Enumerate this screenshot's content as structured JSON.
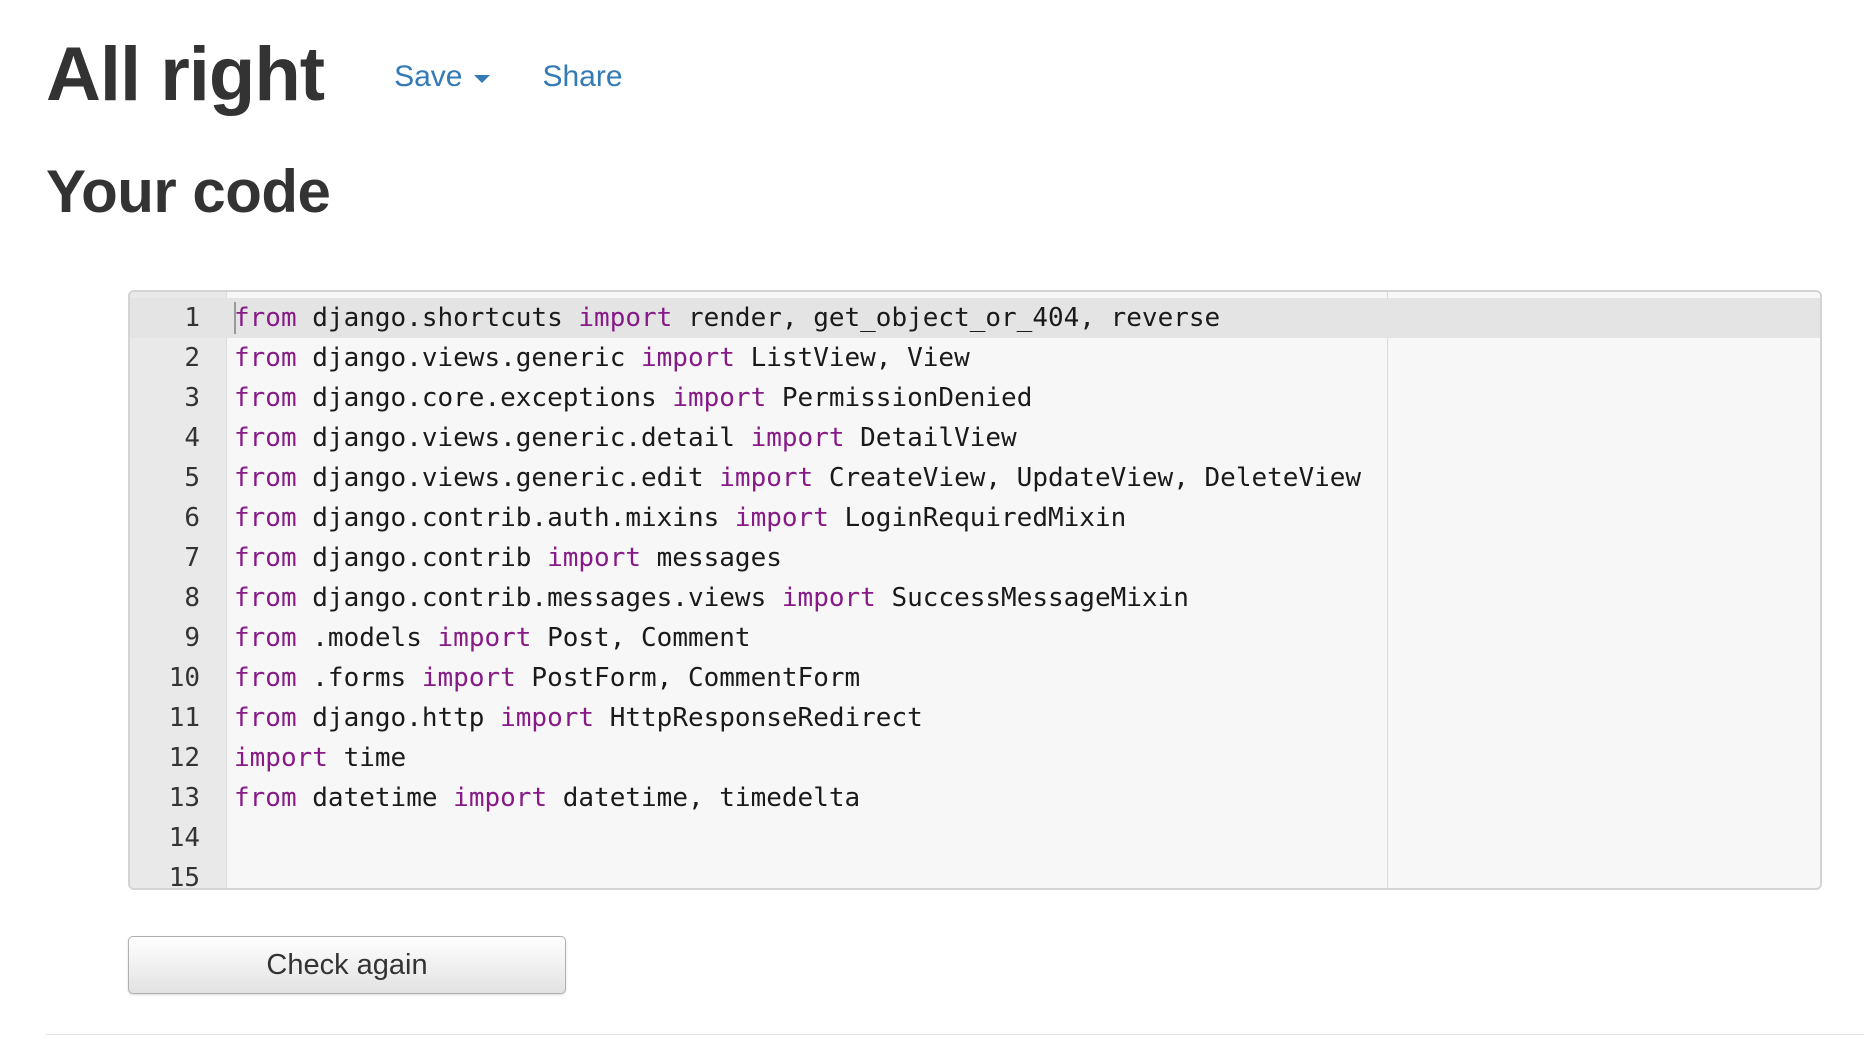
{
  "header": {
    "title": "All right",
    "save_label": "Save",
    "share_label": "Share"
  },
  "section_title": "Your code",
  "editor": {
    "lines": [
      {
        "number": "1",
        "tokens": [
          {
            "t": "from",
            "kw": true
          },
          {
            "t": " django.shortcuts ",
            "kw": false
          },
          {
            "t": "import",
            "kw": true
          },
          {
            "t": " render, get_object_or_404, reverse",
            "kw": false
          }
        ]
      },
      {
        "number": "2",
        "tokens": [
          {
            "t": "from",
            "kw": true
          },
          {
            "t": " django.views.generic ",
            "kw": false
          },
          {
            "t": "import",
            "kw": true
          },
          {
            "t": " ListView, View",
            "kw": false
          }
        ]
      },
      {
        "number": "3",
        "tokens": [
          {
            "t": "from",
            "kw": true
          },
          {
            "t": " django.core.exceptions ",
            "kw": false
          },
          {
            "t": "import",
            "kw": true
          },
          {
            "t": " PermissionDenied",
            "kw": false
          }
        ]
      },
      {
        "number": "4",
        "tokens": [
          {
            "t": "from",
            "kw": true
          },
          {
            "t": " django.views.generic.detail ",
            "kw": false
          },
          {
            "t": "import",
            "kw": true
          },
          {
            "t": " DetailView",
            "kw": false
          }
        ]
      },
      {
        "number": "5",
        "tokens": [
          {
            "t": "from",
            "kw": true
          },
          {
            "t": " django.views.generic.edit ",
            "kw": false
          },
          {
            "t": "import",
            "kw": true
          },
          {
            "t": " CreateView, UpdateView, DeleteView",
            "kw": false
          }
        ]
      },
      {
        "number": "6",
        "tokens": [
          {
            "t": "from",
            "kw": true
          },
          {
            "t": " django.contrib.auth.mixins ",
            "kw": false
          },
          {
            "t": "import",
            "kw": true
          },
          {
            "t": " LoginRequiredMixin",
            "kw": false
          }
        ]
      },
      {
        "number": "7",
        "tokens": [
          {
            "t": "from",
            "kw": true
          },
          {
            "t": " django.contrib ",
            "kw": false
          },
          {
            "t": "import",
            "kw": true
          },
          {
            "t": " messages",
            "kw": false
          }
        ]
      },
      {
        "number": "8",
        "tokens": [
          {
            "t": "from",
            "kw": true
          },
          {
            "t": " django.contrib.messages.views ",
            "kw": false
          },
          {
            "t": "import",
            "kw": true
          },
          {
            "t": " SuccessMessageMixin",
            "kw": false
          }
        ]
      },
      {
        "number": "9",
        "tokens": [
          {
            "t": "from",
            "kw": true
          },
          {
            "t": " .models ",
            "kw": false
          },
          {
            "t": "import",
            "kw": true
          },
          {
            "t": " Post, Comment",
            "kw": false
          }
        ]
      },
      {
        "number": "10",
        "tokens": [
          {
            "t": "from",
            "kw": true
          },
          {
            "t": " .forms ",
            "kw": false
          },
          {
            "t": "import",
            "kw": true
          },
          {
            "t": " PostForm, CommentForm",
            "kw": false
          }
        ]
      },
      {
        "number": "11",
        "tokens": [
          {
            "t": "from",
            "kw": true
          },
          {
            "t": " django.http ",
            "kw": false
          },
          {
            "t": "import",
            "kw": true
          },
          {
            "t": " HttpResponseRedirect",
            "kw": false
          }
        ]
      },
      {
        "number": "12",
        "tokens": [
          {
            "t": "import",
            "kw": true
          },
          {
            "t": " time",
            "kw": false
          }
        ]
      },
      {
        "number": "13",
        "tokens": [
          {
            "t": "from",
            "kw": true
          },
          {
            "t": " datetime ",
            "kw": false
          },
          {
            "t": "import",
            "kw": true
          },
          {
            "t": " datetime, timedelta",
            "kw": false
          }
        ]
      },
      {
        "number": "14",
        "tokens": []
      },
      {
        "number": "15",
        "tokens": []
      }
    ]
  },
  "check_button_label": "Check again",
  "colors": {
    "link": "#337ab7",
    "keyword": "#881a88",
    "text": "#333333"
  },
  "icons": {
    "save_dropdown": "caret-down-icon"
  }
}
